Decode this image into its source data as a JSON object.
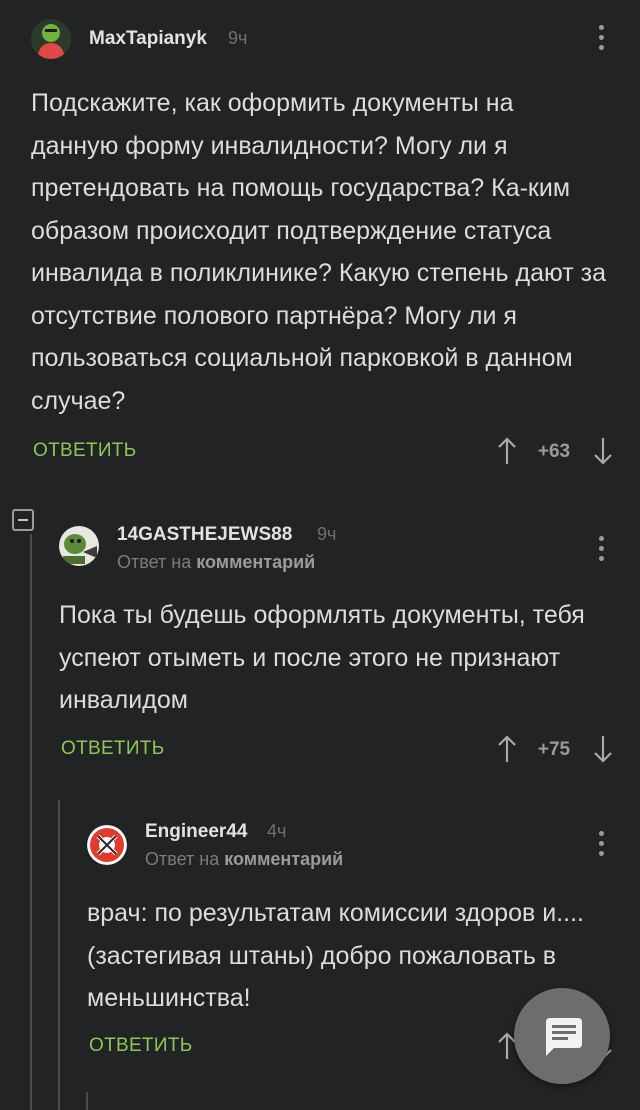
{
  "comments": [
    {
      "username": "MaxTapianyk",
      "time": "9ч",
      "text": "Подскажите, как оформить документы на данную форму инвалидности? Могу ли я претендовать на помощь государства? Ка-ким образом происходит подтверждение статуса инвалида в поликлинике? Какую степень дают за отсутствие полового партнёра? Могу ли я пользоваться социальной парковкой в данном случае?",
      "reply_label": "ОТВЕТИТЬ",
      "rating": "+63"
    },
    {
      "username": "14GASTHEJEWS88",
      "time": "9ч",
      "reply_prefix": "Ответ на",
      "reply_target": "комментарий",
      "text": "Пока ты будешь оформлять документы, тебя успеют отыметь и после этого не признают инвалидом",
      "reply_label": "ОТВЕТИТЬ",
      "rating": "+75"
    },
    {
      "username": "Engineer44",
      "time": "4ч",
      "reply_prefix": "Ответ на",
      "reply_target": "комментарий",
      "text": "врач: по результатам комиссии здоров и....(застегивая штаны) добро пожаловать в меньшинства!",
      "reply_label": "ОТВЕТИТЬ"
    }
  ],
  "icons": {
    "upvote": "arrow-up-icon",
    "downvote": "arrow-down-icon",
    "more": "more-vertical-icon",
    "collapse": "collapse-minus-icon",
    "fab": "comment-icon"
  },
  "colors": {
    "background": "#222324",
    "accent": "#8ac858",
    "text": "#dcdcdc"
  }
}
